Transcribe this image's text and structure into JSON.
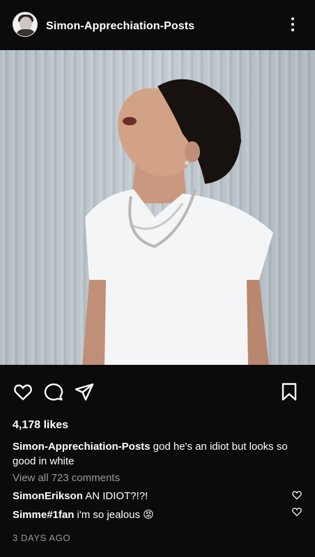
{
  "header": {
    "username": "Simon-Apprechiation-Posts",
    "avatar_icon": "profile-photo",
    "more_icon": "more-vertical-icon"
  },
  "post": {
    "image_description_icon": "post-photo",
    "actions": {
      "like_icon": "heart-outline-icon",
      "comment_icon": "comment-bubble-icon",
      "share_icon": "send-paper-plane-icon",
      "save_icon": "bookmark-outline-icon"
    },
    "likes_text": "4,178 likes",
    "caption": {
      "username": "Simon-Apprechiation-Posts",
      "text": " god he's an idiot but looks so good in white"
    },
    "view_all_comments": "View all 723 comments",
    "comments": [
      {
        "username": "SimonErikson",
        "text": " AN IDIOT?!?!"
      },
      {
        "username": "Simme#1fan",
        "text": " i'm so jealous 😡"
      }
    ],
    "timestamp": "3 DAYS AGO"
  },
  "colors": {
    "background": "#0b0b0b",
    "text": "#ffffff",
    "muted": "#9a9a9a"
  }
}
